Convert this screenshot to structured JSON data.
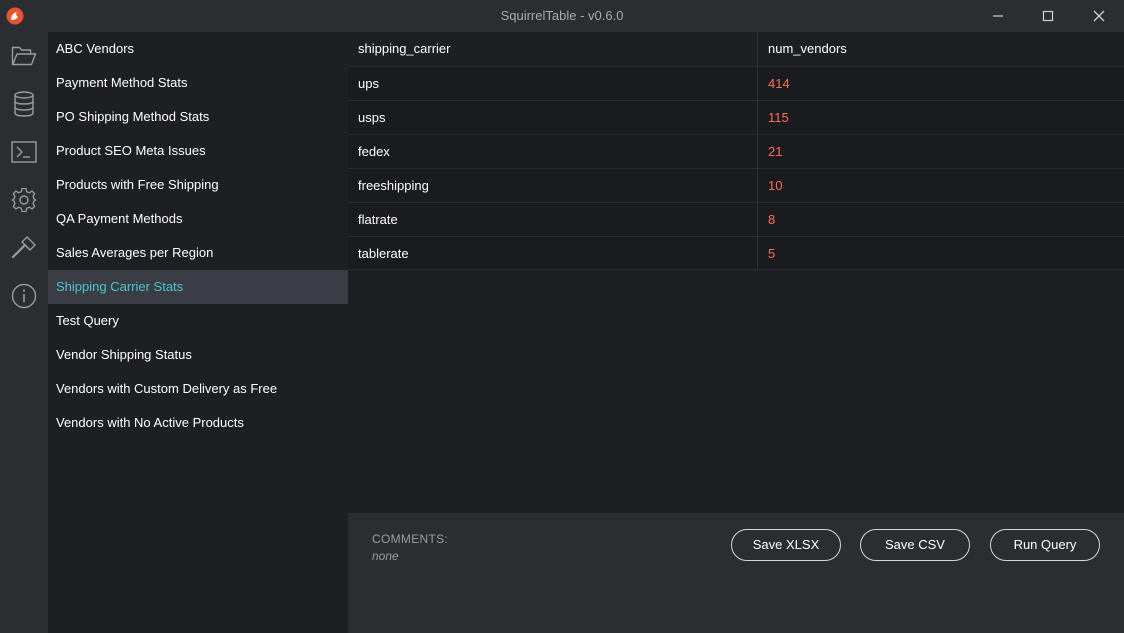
{
  "window": {
    "title": "SquirrelTable - v0.6.0",
    "controls": {
      "minimize_icon": "minimize-icon",
      "maximize_icon": "maximize-icon",
      "close_icon": "close-icon"
    }
  },
  "iconbar": {
    "items": [
      {
        "icon": "folder-icon"
      },
      {
        "icon": "database-icon"
      },
      {
        "icon": "terminal-icon"
      },
      {
        "icon": "gear-icon"
      },
      {
        "icon": "hammer-icon"
      },
      {
        "icon": "info-icon"
      }
    ]
  },
  "sidebar": {
    "items": [
      {
        "label": "ABC Vendors"
      },
      {
        "label": "Payment Method Stats"
      },
      {
        "label": "PO Shipping Method Stats"
      },
      {
        "label": "Product SEO Meta Issues"
      },
      {
        "label": "Products with Free Shipping"
      },
      {
        "label": "QA Payment Methods"
      },
      {
        "label": "Sales Averages per Region"
      },
      {
        "label": "Shipping Carrier Stats",
        "active": true
      },
      {
        "label": "Test Query"
      },
      {
        "label": "Vendor Shipping Status"
      },
      {
        "label": "Vendors with Custom Delivery as Free"
      },
      {
        "label": "Vendors with No Active Products"
      }
    ]
  },
  "table": {
    "columns": [
      "shipping_carrier",
      "num_vendors"
    ],
    "rows": [
      [
        "ups",
        "414"
      ],
      [
        "usps",
        "115"
      ],
      [
        "fedex",
        "21"
      ],
      [
        "freeshipping",
        "10"
      ],
      [
        "flatrate",
        "8"
      ],
      [
        "tablerate",
        "5"
      ]
    ]
  },
  "footer": {
    "comments_label": "COMMENTS:",
    "comments_value": "none",
    "save_xlsx": "Save XLSX",
    "save_csv": "Save CSV",
    "run_query": "Run Query"
  },
  "colors": {
    "accent": "#4fc4d0",
    "number": "#ff6b5a",
    "titlebar": "#2b2d31",
    "background": "#1e1f22"
  }
}
